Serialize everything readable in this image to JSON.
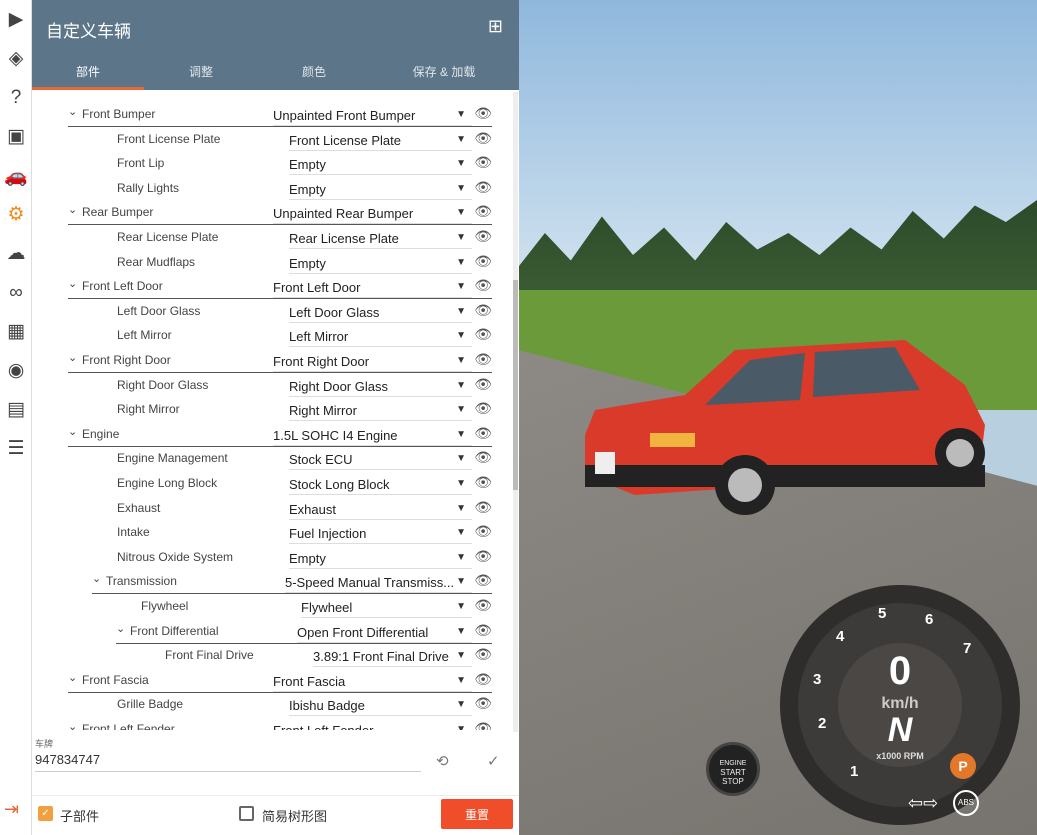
{
  "header": {
    "title": "自定义车辆",
    "tabs": [
      "部件",
      "调整",
      "颜色",
      "保存 & 加载"
    ]
  },
  "rail_icons": [
    "play-icon",
    "layers-icon",
    "help-icon",
    "mission-icon",
    "car-icon",
    "gear-icon",
    "cloud-icon",
    "infinity-icon",
    "film-icon",
    "camera-icon",
    "window-icon",
    "sliders-icon"
  ],
  "parts": [
    {
      "label": "Front Bumper",
      "value": "Unpainted Front Bumper",
      "depth": 1,
      "expandable": true
    },
    {
      "label": "Front License Plate",
      "value": "Front License Plate",
      "depth": 2,
      "expandable": false
    },
    {
      "label": "Front Lip",
      "value": "Empty",
      "depth": 2,
      "expandable": false
    },
    {
      "label": "Rally Lights",
      "value": "Empty",
      "depth": 2,
      "expandable": false
    },
    {
      "label": "Rear Bumper",
      "value": "Unpainted Rear Bumper",
      "depth": 1,
      "expandable": true
    },
    {
      "label": "Rear License Plate",
      "value": "Rear License Plate",
      "depth": 2,
      "expandable": false
    },
    {
      "label": "Rear Mudflaps",
      "value": "Empty",
      "depth": 2,
      "expandable": false
    },
    {
      "label": "Front Left Door",
      "value": "Front Left Door",
      "depth": 1,
      "expandable": true
    },
    {
      "label": "Left Door Glass",
      "value": "Left Door Glass",
      "depth": 2,
      "expandable": false
    },
    {
      "label": "Left Mirror",
      "value": "Left Mirror",
      "depth": 2,
      "expandable": false
    },
    {
      "label": "Front Right Door",
      "value": "Front Right Door",
      "depth": 1,
      "expandable": true
    },
    {
      "label": "Right Door Glass",
      "value": "Right Door Glass",
      "depth": 2,
      "expandable": false
    },
    {
      "label": "Right Mirror",
      "value": "Right Mirror",
      "depth": 2,
      "expandable": false
    },
    {
      "label": "Engine",
      "value": "1.5L SOHC I4 Engine",
      "depth": 1,
      "expandable": true
    },
    {
      "label": "Engine Management",
      "value": "Stock ECU",
      "depth": 2,
      "expandable": false
    },
    {
      "label": "Engine Long Block",
      "value": "Stock Long Block",
      "depth": 2,
      "expandable": false
    },
    {
      "label": "Exhaust",
      "value": "Exhaust",
      "depth": 2,
      "expandable": false
    },
    {
      "label": "Intake",
      "value": "Fuel Injection",
      "depth": 2,
      "expandable": false
    },
    {
      "label": "Nitrous Oxide System",
      "value": "Empty",
      "depth": 2,
      "expandable": false
    },
    {
      "label": "Transmission",
      "value": "5-Speed Manual Transmiss...",
      "depth": 2,
      "expandable": true
    },
    {
      "label": "Flywheel",
      "value": "Flywheel",
      "depth": 3,
      "expandable": false
    },
    {
      "label": "Front Differential",
      "value": "Open Front Differential",
      "depth": 3,
      "expandable": true
    },
    {
      "label": "Front Final Drive",
      "value": "3.89:1 Front Final Drive",
      "depth": 4,
      "expandable": false
    },
    {
      "label": "Front Fascia",
      "value": "Front Fascia",
      "depth": 1,
      "expandable": true
    },
    {
      "label": "Grille Badge",
      "value": "Ibishu Badge",
      "depth": 2,
      "expandable": false
    },
    {
      "label": "Front Left Fender",
      "value": "Front Left Fender",
      "depth": 1,
      "expandable": true
    }
  ],
  "plate": {
    "label": "车牌",
    "value": "947834747"
  },
  "footer": {
    "subparts_label": "子部件",
    "subparts_checked": true,
    "simple_tree_label": "简易树形图",
    "simple_tree_checked": false,
    "reset_label": "重置"
  },
  "hud": {
    "speed": "0",
    "speed_unit": "km/h",
    "gear": "N",
    "rpm_label": "x1000 RPM",
    "rpm_ticks": [
      "1",
      "2",
      "3",
      "4",
      "5",
      "6",
      "7"
    ],
    "start_stop": [
      "ENGINE",
      "START",
      "STOP"
    ],
    "abs": "ABS",
    "parking": "P"
  },
  "colors": {
    "header": "#5c7588",
    "accent": "#e4693a",
    "reset": "#f04e2a"
  }
}
